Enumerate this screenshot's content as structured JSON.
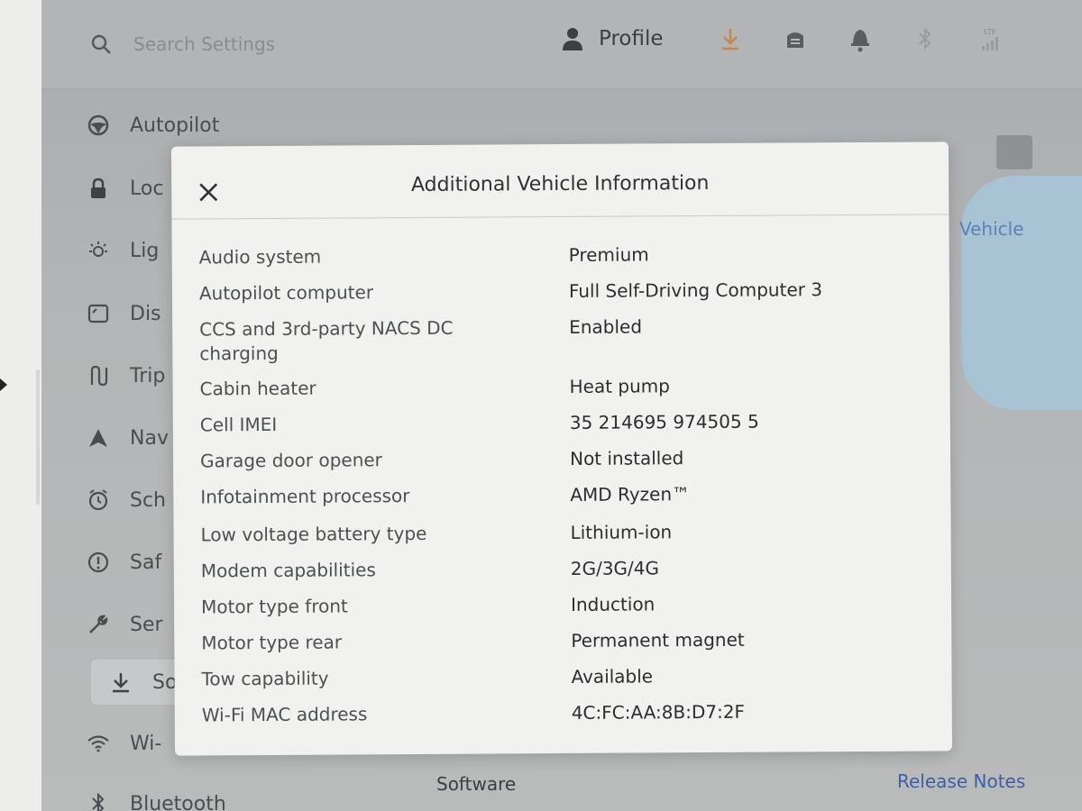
{
  "search": {
    "placeholder": "Search Settings"
  },
  "header": {
    "profile_label": "Profile",
    "status_icons": [
      "download-icon",
      "glovebox-icon",
      "bell-icon",
      "bluetooth-icon",
      "lte-signal-icon"
    ],
    "lte_label": "LTE"
  },
  "sidebar": {
    "items": [
      {
        "label": "Autopilot",
        "icon": "steering-wheel-icon"
      },
      {
        "label": "Loc",
        "icon": "lock-icon"
      },
      {
        "label": "Lig",
        "icon": "light-icon"
      },
      {
        "label": "Dis",
        "icon": "display-icon"
      },
      {
        "label": "Trip",
        "icon": "trip-icon"
      },
      {
        "label": "Nav",
        "icon": "navigation-icon"
      },
      {
        "label": "Sch",
        "icon": "schedule-icon"
      },
      {
        "label": "Saf",
        "icon": "safety-icon"
      },
      {
        "label": "Ser",
        "icon": "wrench-icon"
      },
      {
        "label": "Sof",
        "icon": "download-icon"
      },
      {
        "label": "Wi-",
        "icon": "wifi-icon"
      },
      {
        "label": "Bluetooth",
        "icon": "bluetooth-icon"
      }
    ],
    "active_index": 9
  },
  "background": {
    "vehicle_link": "Vehicle",
    "software_label": "Software",
    "release_notes_link": "Release Notes"
  },
  "modal": {
    "title": "Additional Vehicle Information",
    "rows": [
      {
        "label": "Audio system",
        "value": "Premium"
      },
      {
        "label": "Autopilot computer",
        "value": "Full Self-Driving Computer 3"
      },
      {
        "label": "CCS and 3rd-party NACS DC charging",
        "value": "Enabled"
      },
      {
        "label": "Cabin heater",
        "value": "Heat pump"
      },
      {
        "label": "Cell IMEI",
        "value": "35 214695 974505 5"
      },
      {
        "label": "Garage door opener",
        "value": "Not installed"
      },
      {
        "label": "Infotainment processor",
        "value": "AMD Ryzen™"
      },
      {
        "label": "Low voltage battery type",
        "value": "Lithium-ion"
      },
      {
        "label": "Modem capabilities",
        "value": "2G/3G/4G"
      },
      {
        "label": "Motor type front",
        "value": "Induction"
      },
      {
        "label": "Motor type rear",
        "value": "Permanent magnet"
      },
      {
        "label": "Tow capability",
        "value": "Available"
      },
      {
        "label": "Wi-Fi MAC address",
        "value": "4C:FC:AA:8B:D7:2F"
      }
    ]
  },
  "colors": {
    "accent": "#3d5fa6",
    "modal_bg": "#f1f1ef",
    "dim_bg": "#b3b5b6"
  }
}
